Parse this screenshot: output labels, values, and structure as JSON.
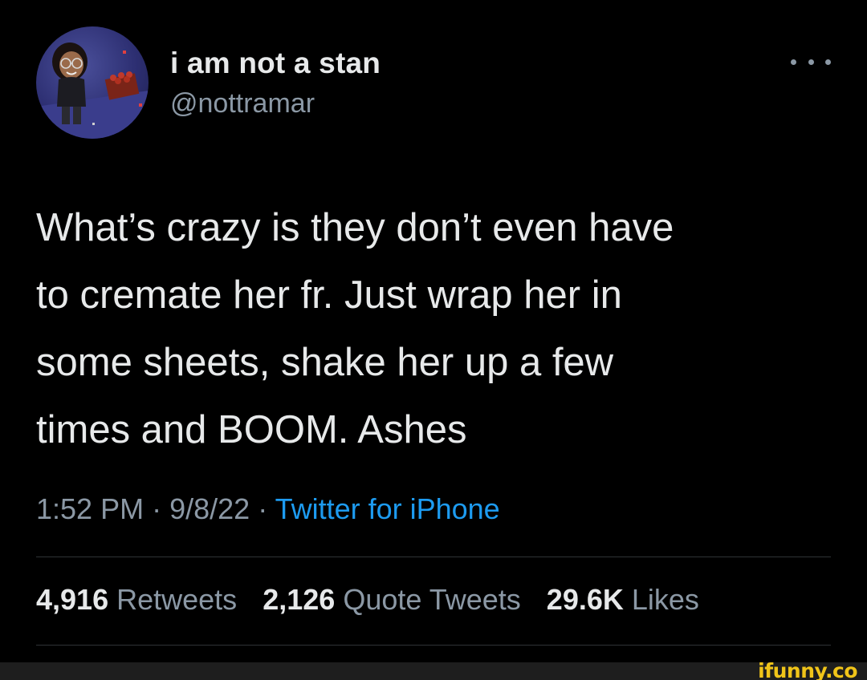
{
  "author": {
    "display_name": "i am not a stan",
    "handle": "@nottramar",
    "avatar_icon": "cartoon-avatar-icon"
  },
  "tweet": {
    "lines": [
      "What’s crazy is they don’t even have",
      "to cremate her fr. Just wrap her in",
      "some sheets, shake her up a few",
      "times and BOOM. Ashes"
    ],
    "time": "1:52 PM",
    "separator": "·",
    "date": "9/8/22",
    "source": "Twitter for iPhone"
  },
  "stats": {
    "retweets_count": "4,916",
    "retweets_label": "Retweets",
    "quotes_count": "2,126",
    "quotes_label": "Quote Tweets",
    "likes_count": "29.6K",
    "likes_label": "Likes"
  },
  "watermark": "ifunny.co",
  "colors": {
    "background": "#000000",
    "text_primary": "#e7e9ea",
    "text_secondary": "#8b98a5",
    "link": "#1d9bf0",
    "divider": "#2f3336",
    "watermark": "#f0c419"
  }
}
